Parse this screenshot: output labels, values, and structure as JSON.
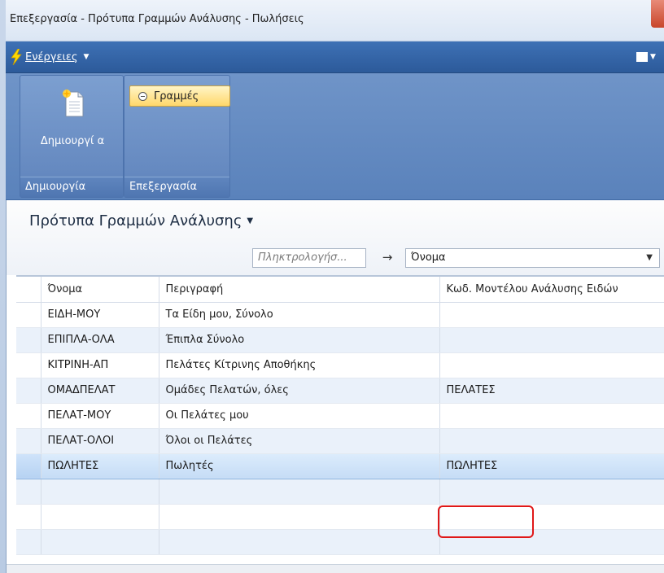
{
  "window": {
    "title": "Επεξεργασία - Πρότυπα Γραμμών Ανάλυσης - Πωλήσεις"
  },
  "actionbar": {
    "actions_label": "Ενέργειες",
    "bolt_color": "#ffd800"
  },
  "ribbon": {
    "groups": [
      {
        "label": "Δημιουργία",
        "button_label": "Δημιουργί α",
        "icon": "new-document-icon"
      },
      {
        "label": "Επεξεργασία",
        "button_label": "Γραμμές",
        "icon": "lines-radio-icon"
      }
    ]
  },
  "page": {
    "title": "Πρότυπα Γραμμών Ανάλυσης",
    "search_placeholder": "Πληκτρολογήσ...",
    "filter_field": "Όνομα",
    "arrow_glyph": "→"
  },
  "table": {
    "columns": [
      "Όνομα",
      "Περιγραφή",
      "Κωδ. Μοντέλου Ανάλυσης Ειδών"
    ],
    "rows": [
      {
        "name": "ΕΙΔΗ-ΜΟΥ",
        "description": "Τα Είδη μου, Σύνολο",
        "code": ""
      },
      {
        "name": "ΕΠΙΠΛΑ-ΟΛΑ",
        "description": "Έπιπλα Σύνολο",
        "code": ""
      },
      {
        "name": "ΚΙΤΡΙΝΗ-ΑΠ",
        "description": "Πελάτες Κίτρινης Αποθήκης",
        "code": ""
      },
      {
        "name": "ΟΜΑΔΠΕΛΑΤ",
        "description": "Ομάδες Πελατών, όλες",
        "code": "ΠΕΛΑΤΕΣ"
      },
      {
        "name": "ΠΕΛΑΤ-ΜΟΥ",
        "description": "Οι Πελάτες μου",
        "code": ""
      },
      {
        "name": "ΠΕΛΑΤ-ΟΛΟΙ",
        "description": "Όλοι οι Πελάτες",
        "code": ""
      },
      {
        "name": "ΠΩΛΗΤΕΣ",
        "description": "Πωλητές",
        "code": "ΠΩΛΗΤΕΣ"
      }
    ]
  },
  "colors": {
    "accent": "#2f5f9e",
    "selected_row": "#c5dcf6",
    "highlight_border": "#e01818"
  }
}
